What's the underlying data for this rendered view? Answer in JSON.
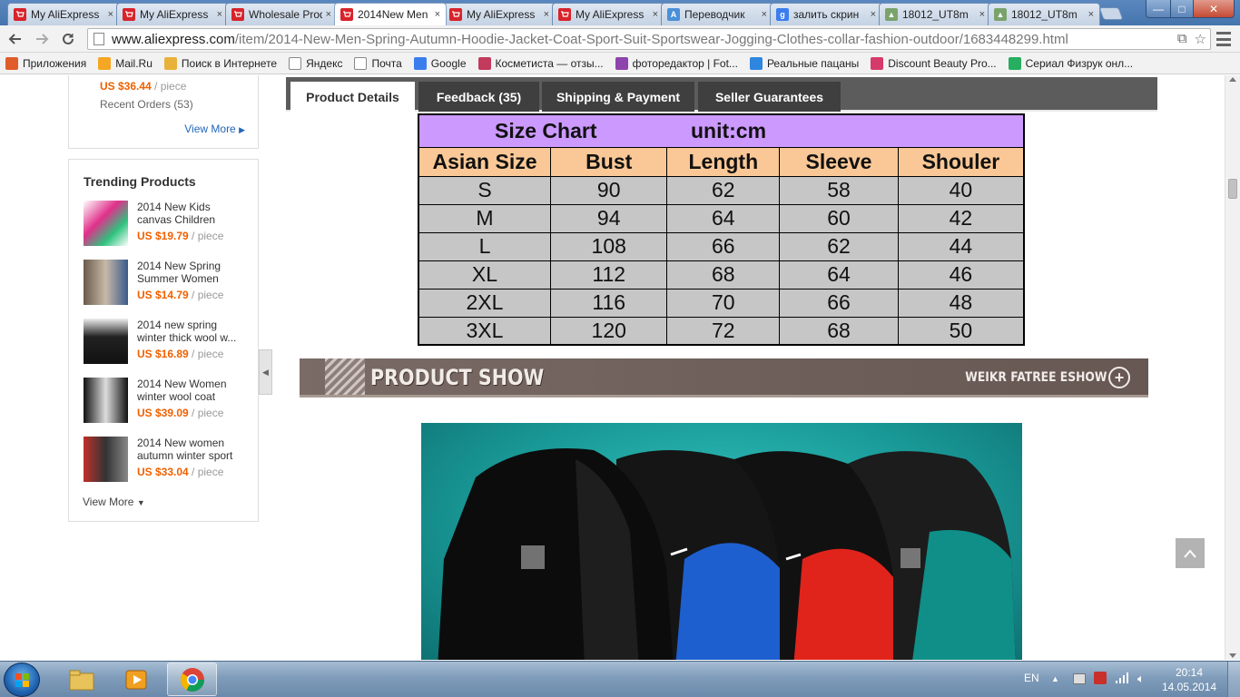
{
  "browser": {
    "tabs": [
      {
        "title": "My AliExpress",
        "icon": "aliexpress-icon"
      },
      {
        "title": "My AliExpress",
        "icon": "aliexpress-icon"
      },
      {
        "title": "Wholesale Products",
        "icon": "aliexpress-icon"
      },
      {
        "title": "2014New Men",
        "icon": "aliexpress-icon",
        "active": true
      },
      {
        "title": "My AliExpress",
        "icon": "aliexpress-icon"
      },
      {
        "title": "My AliExpress",
        "icon": "aliexpress-icon"
      },
      {
        "title": "Переводчик",
        "icon": "translate-icon"
      },
      {
        "title": "залить скрин",
        "icon": "google-icon"
      },
      {
        "title": "18012_UT8m",
        "icon": "image-icon"
      },
      {
        "title": "18012_UT8m",
        "icon": "image-icon"
      }
    ],
    "tab_close": "×",
    "window_min": "—",
    "window_max": "□",
    "window_close": "✕",
    "url_host": "www.aliexpress.com",
    "url_path": "/item/2014-New-Men-Spring-Autumn-Hoodie-Jacket-Coat-Sport-Suit-Sportswear-Jogging-Clothes-collar-fashion-outdoor/1683448299.html",
    "bookmarks": [
      {
        "label": "Приложения",
        "color": "#e05c2a"
      },
      {
        "label": "Mail.Ru",
        "color": "#f5a623"
      },
      {
        "label": "Поиск в Интернете",
        "color": "#e8b23a"
      },
      {
        "label": "Яндекс",
        "color": "#ffffff"
      },
      {
        "label": "Почта",
        "color": "#ffffff"
      },
      {
        "label": "Google",
        "color": "#3b7ded"
      },
      {
        "label": "Косметиста — отзы...",
        "color": "#c23a5c"
      },
      {
        "label": "фоторедактор | Fot...",
        "color": "#8e44ad"
      },
      {
        "label": "Реальные пацаны",
        "color": "#2e86de"
      },
      {
        "label": "Discount Beauty Pro...",
        "color": "#d63a6b"
      },
      {
        "label": "Сериал Физрук онл...",
        "color": "#27ae60"
      }
    ]
  },
  "sidebar": {
    "top_price_value": "US $36.44",
    "top_price_unit": " / piece",
    "recent_orders": "Recent Orders (53)",
    "view_more": "View More",
    "trending_title": "Trending Products",
    "trending": [
      {
        "name": "2014 New Kids canvas Children",
        "price": "US $19.79",
        "unit": " / piece"
      },
      {
        "name": "2014 New Spring Summer Women",
        "price": "US $14.79",
        "unit": " / piece"
      },
      {
        "name": "2014 new spring winter thick wool w...",
        "price": "US $16.89",
        "unit": " / piece"
      },
      {
        "name": "2014 New Women winter wool coat",
        "price": "US $39.09",
        "unit": " / piece"
      },
      {
        "name": "2014 New women autumn winter sport",
        "price": "US $33.04",
        "unit": " / piece"
      }
    ],
    "view_more_bottom": "View More"
  },
  "product_tabs": [
    {
      "label": "Product Details",
      "active": true
    },
    {
      "label": "Feedback (35)"
    },
    {
      "label": "Shipping & Payment"
    },
    {
      "label": "Seller Guarantees"
    }
  ],
  "size_chart": {
    "title": "Size Chart",
    "unit": "unit:cm",
    "headers": [
      "Asian Size",
      "Bust",
      "Length",
      "Sleeve",
      "Shouler"
    ],
    "rows": [
      [
        "S",
        "90",
        "62",
        "58",
        "40"
      ],
      [
        "M",
        "94",
        "64",
        "60",
        "42"
      ],
      [
        "L",
        "108",
        "66",
        "62",
        "44"
      ],
      [
        "XL",
        "112",
        "68",
        "64",
        "46"
      ],
      [
        "2XL",
        "116",
        "70",
        "66",
        "48"
      ],
      [
        "3XL",
        "120",
        "72",
        "68",
        "50"
      ]
    ]
  },
  "banner": {
    "title": "PRODUCT SHOW",
    "subtitle": "WEIKR FATREE ESHOW"
  },
  "taskbar": {
    "lang": "EN",
    "time": "20:14",
    "date": "14.05.2014"
  }
}
